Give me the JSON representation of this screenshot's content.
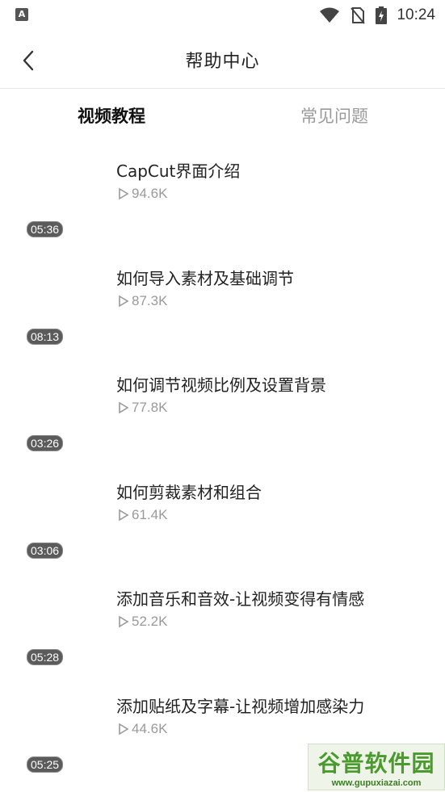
{
  "status_bar": {
    "app_icon_letter": "A",
    "time": "10:24"
  },
  "header": {
    "title": "帮助中心",
    "back_icon": "chevron-left-icon"
  },
  "tabs": [
    {
      "label": "视频教程",
      "active": true
    },
    {
      "label": "常见问题",
      "active": false
    }
  ],
  "videos": [
    {
      "title": "CapCut界面介绍",
      "views": "94.6K",
      "duration": "05:36"
    },
    {
      "title": "如何导入素材及基础调节",
      "views": "87.3K",
      "duration": "08:13"
    },
    {
      "title": "如何调节视频比例及设置背景",
      "views": "77.8K",
      "duration": "03:26"
    },
    {
      "title": "如何剪裁素材和组合",
      "views": "61.4K",
      "duration": "03:06"
    },
    {
      "title": "添加音乐和音效-让视频变得有情感",
      "views": "52.2K",
      "duration": "05:28"
    },
    {
      "title": "添加贴纸及字幕-让视频增加感染力",
      "views": "44.6K",
      "duration": "05:25"
    }
  ],
  "watermark": {
    "main": "谷普软件园",
    "url": "www.gupuxiazai.com"
  }
}
